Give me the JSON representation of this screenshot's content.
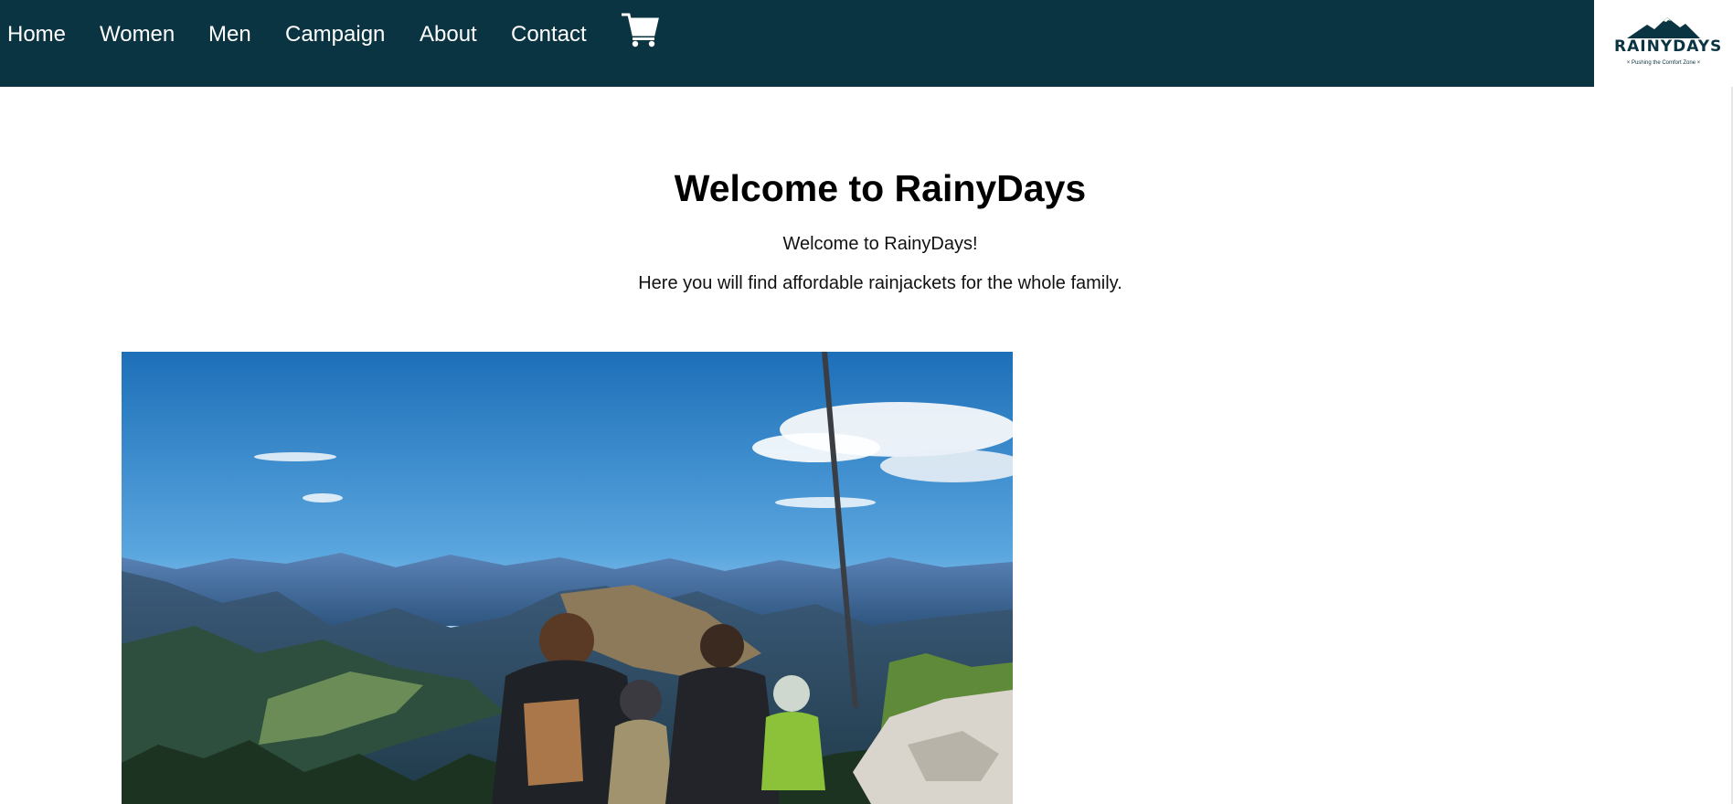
{
  "nav": {
    "items": [
      {
        "label": "Home"
      },
      {
        "label": "Women"
      },
      {
        "label": "Men"
      },
      {
        "label": "Campaign"
      },
      {
        "label": "About"
      },
      {
        "label": "Contact"
      }
    ],
    "cart_icon": "shopping-cart-icon",
    "background": "#0b3442"
  },
  "logo": {
    "wordmark": "RAINYDAYS",
    "tagline": "× Pushing the Comfort Zone ×",
    "icon": "mountain-icon"
  },
  "main": {
    "heading": "Welcome to RainyDays",
    "paragraphs": [
      "Welcome to RainyDays!",
      "Here you will find affordable rainjackets for the whole family."
    ]
  }
}
